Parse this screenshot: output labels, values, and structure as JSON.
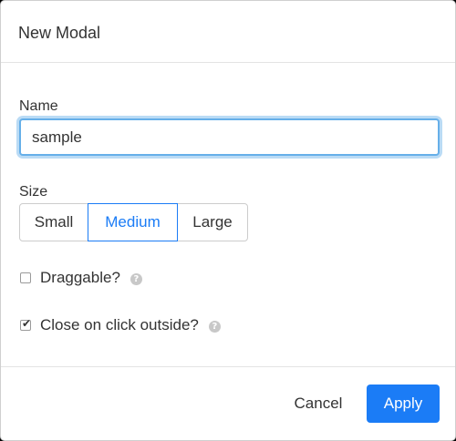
{
  "modal": {
    "title": "New Modal"
  },
  "form": {
    "name_label": "Name",
    "name_value": "sample",
    "size_label": "Size",
    "size_options": [
      "Small",
      "Medium",
      "Large"
    ],
    "size_selected": "Medium",
    "draggable_label": "Draggable?",
    "draggable_checked": false,
    "close_outside_label": "Close on click outside?",
    "close_outside_checked": true,
    "help_glyph": "?",
    "check_glyph": "✔"
  },
  "footer": {
    "cancel_label": "Cancel",
    "apply_label": "Apply"
  },
  "colors": {
    "accent": "#1b7cf6",
    "focus_ring": "#66afe9",
    "help_icon": "#c8c8c8",
    "backdrop": "#000000"
  },
  "icons": {
    "help": "question-circle-icon",
    "checkmark": "checkmark-icon"
  }
}
